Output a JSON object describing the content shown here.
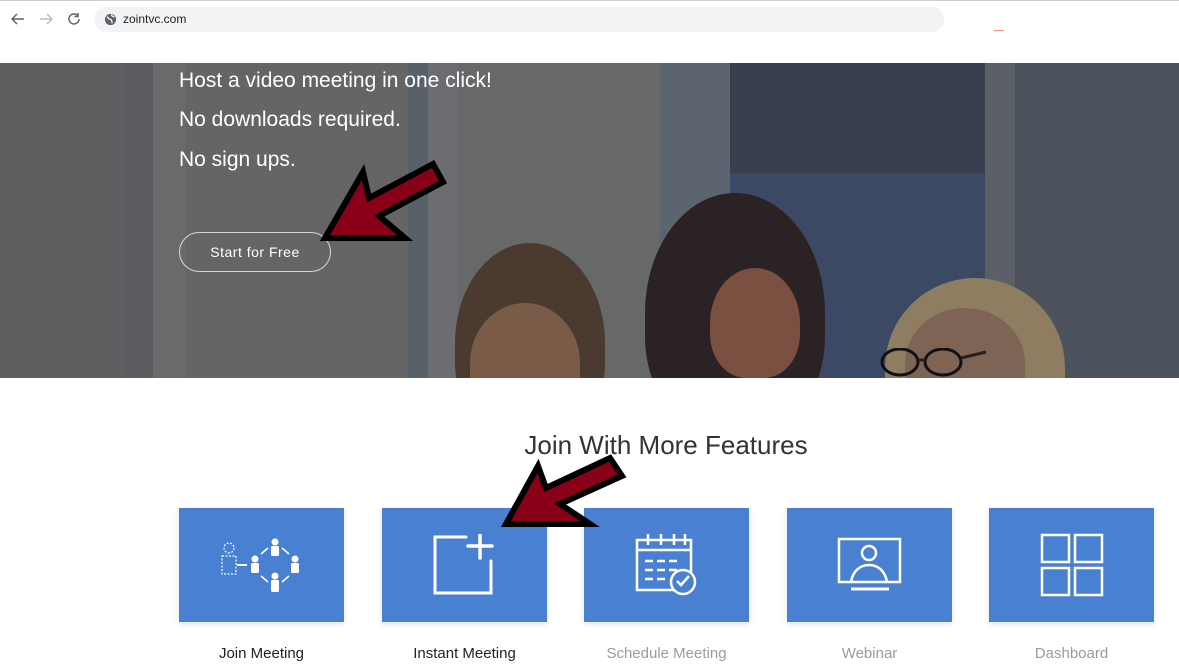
{
  "browser": {
    "back_icon": "arrow-left-icon",
    "forward_icon": "arrow-right-icon",
    "reload_icon": "reload-icon",
    "site_icon": "globe-icon",
    "url": "zointvc.com"
  },
  "hero": {
    "lines": [
      "Host a video meeting in one click!",
      "No downloads required.",
      "No sign ups."
    ],
    "cta_label": "Start for Free"
  },
  "features": {
    "title": "Join With More Features",
    "items": [
      {
        "label": "Join Meeting",
        "icon": "network-people-icon"
      },
      {
        "label": "Instant Meeting",
        "icon": "add-square-icon"
      },
      {
        "label": "Schedule Meeting",
        "icon": "calendar-check-icon"
      },
      {
        "label": "Webinar",
        "icon": "presenter-screen-icon"
      },
      {
        "label": "Dashboard",
        "icon": "grid-icon"
      }
    ]
  },
  "annotations": {
    "arrow_color": "#8b0019",
    "card_color": "#4a80d1"
  }
}
